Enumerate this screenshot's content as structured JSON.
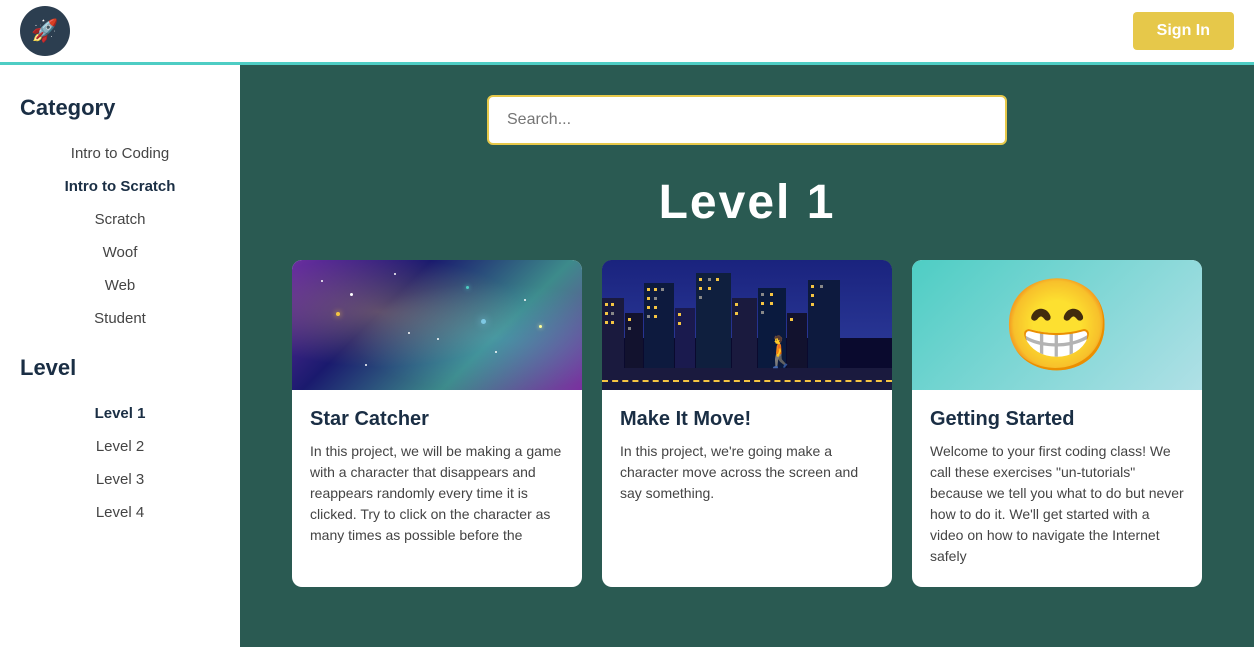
{
  "header": {
    "logo_icon": "🚀",
    "sign_in_label": "Sign In"
  },
  "sidebar": {
    "category_title": "Category",
    "category_items": [
      {
        "label": "Intro to Coding"
      },
      {
        "label": "Intro to Scratch"
      },
      {
        "label": "Scratch"
      },
      {
        "label": "Woof"
      },
      {
        "label": "Web"
      },
      {
        "label": "Student"
      }
    ],
    "level_title": "Level",
    "level_items": [
      {
        "label": "Level 1"
      },
      {
        "label": "Level 2"
      },
      {
        "label": "Level 3"
      },
      {
        "label": "Level 4"
      }
    ]
  },
  "search": {
    "placeholder": "Search..."
  },
  "main": {
    "level_heading": "Level  1",
    "cards": [
      {
        "title": "Star Catcher",
        "description": "In this project, we will be making a game with a character that disappears and reappears randomly every time it is clicked. Try to click on the character as many times as possible before the",
        "image_type": "galaxy"
      },
      {
        "title": "Make It Move!",
        "description": "In this project, we're going make a character move across the screen and say something.",
        "image_type": "city"
      },
      {
        "title": "Getting Started",
        "description": "Welcome to your first coding class! We call these exercises \"un-tutorials\" because we tell you what to do but never how to do it. We'll get started with a video on how to navigate the Internet safely",
        "image_type": "emoji"
      }
    ]
  }
}
